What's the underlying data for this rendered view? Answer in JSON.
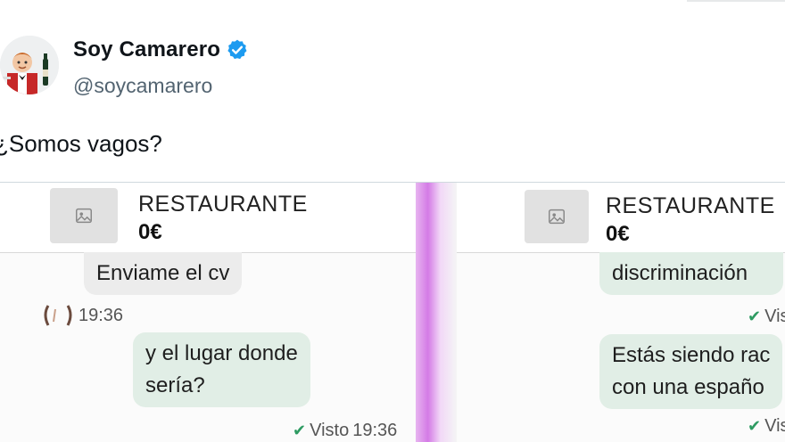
{
  "tweet": {
    "display_name": "Soy Camarero",
    "handle": "@soycamarero",
    "text": "¿Somos vagos?",
    "verified": true,
    "verified_color": "#1d9bf0"
  },
  "media": {
    "left_panel": {
      "listing_title": "RESTAURANTE",
      "listing_price": "0€",
      "messages": [
        {
          "text": "Enviame el cv",
          "direction": "incoming"
        },
        {
          "time": "19:36"
        },
        {
          "text": "y el lugar donde\nsería?",
          "direction": "outgoing",
          "status": "Visto",
          "time": "19:36"
        }
      ]
    },
    "right_panel": {
      "listing_title": "RESTAURANTE",
      "listing_price": "0€",
      "messages": [
        {
          "text": "discriminación",
          "direction": "outgoing",
          "status": "Vis"
        },
        {
          "text": "Estás siendo rac\ncon una españo",
          "direction": "outgoing",
          "status": "Vis"
        }
      ]
    }
  },
  "icons": [
    "waiter-avatar",
    "verified-badge-icon",
    "image-placeholder-icon",
    "check-icon"
  ],
  "colors": {
    "incoming_bubble": "#ececec",
    "outgoing_bubble": "#e1eee6",
    "divider_strip": "#d47be6"
  }
}
